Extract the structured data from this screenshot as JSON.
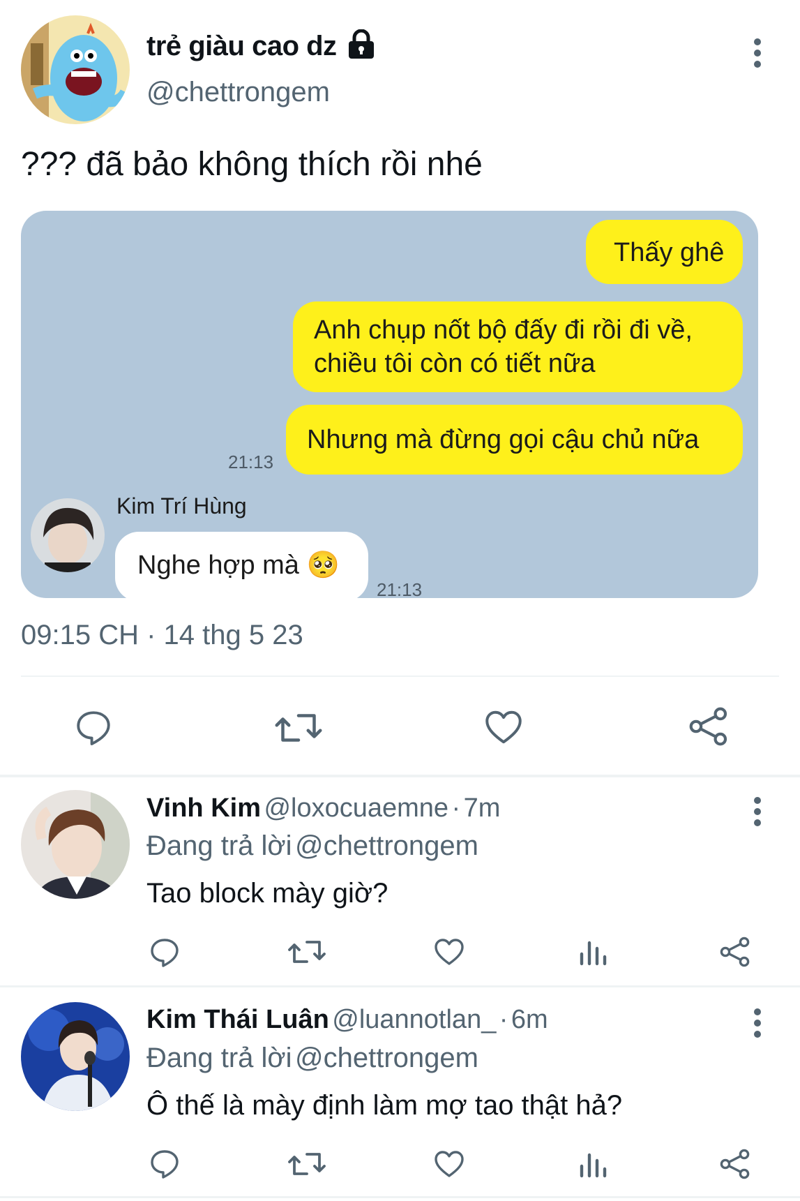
{
  "tweet": {
    "display_name": "trẻ giàu cao dz",
    "handle": "@chettrongem",
    "text": "??? đã bảo không thích rồi nhé",
    "timestamp": "09:15 CH · 14 thg 5 23"
  },
  "chat": {
    "messages_sent": [
      {
        "text": "Thấy ghê"
      },
      {
        "line1": "Anh chụp nốt bộ đấy đi rồi đi về,",
        "line2": "chiều tôi còn có tiết nữa"
      },
      {
        "text": "Nhưng mà đừng gọi cậu chủ nữa"
      }
    ],
    "sent_time": "21:13",
    "sender_name": "Kim Trí Hùng",
    "received_text": "Nghe hợp mà",
    "received_emoji": "🥺",
    "received_time": "21:13"
  },
  "replies": [
    {
      "name": "Vinh Kim",
      "handle": "@loxocuaemne",
      "age": "7m",
      "replying_label": "Đang trả lời",
      "replying_to": "@chettrongem",
      "text": "Tao block mày giờ?"
    },
    {
      "name": "Kim Thái Luân",
      "handle": "@luannotlan_",
      "age": "6m",
      "replying_label": "Đang trả lời",
      "replying_to": "@chettrongem",
      "text": "Ô thế là mày định làm mợ tao thật hả?"
    }
  ],
  "icons": {
    "more": "more-vertical-icon",
    "lock": "lock-icon",
    "reply": "reply-icon",
    "retweet": "retweet-icon",
    "like": "like-icon",
    "analytics": "analytics-icon",
    "share": "share-icon"
  },
  "colors": {
    "accent": "#1d9bf0",
    "chat_bg": "#b2c7da",
    "bubble_yellow": "#fef01b",
    "muted": "#536471"
  }
}
